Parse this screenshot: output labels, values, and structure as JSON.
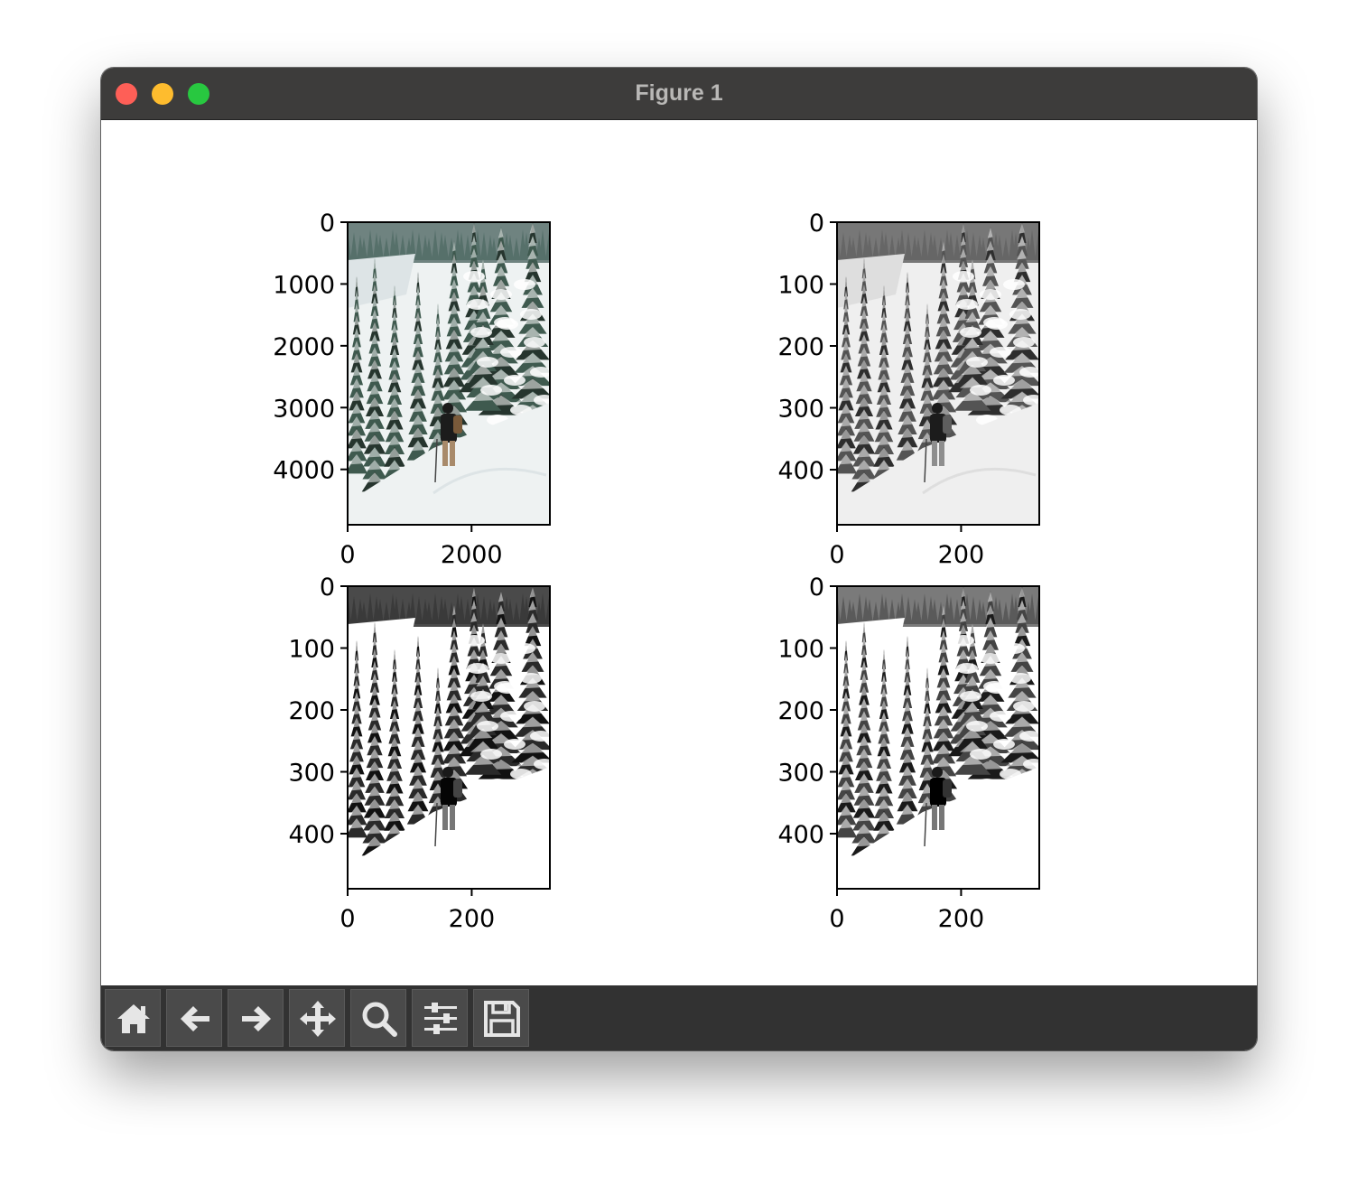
{
  "window": {
    "title": "Figure 1"
  },
  "toolbar": {
    "buttons": [
      {
        "name": "home-button",
        "icon": "home-icon"
      },
      {
        "name": "back-button",
        "icon": "arrow-left-icon"
      },
      {
        "name": "forward-button",
        "icon": "arrow-right-icon"
      },
      {
        "name": "pan-button",
        "icon": "move-icon"
      },
      {
        "name": "zoom-button",
        "icon": "search-icon"
      },
      {
        "name": "configure-subplots-button",
        "icon": "sliders-icon"
      },
      {
        "name": "save-button",
        "icon": "floppy-disk-icon"
      }
    ]
  },
  "chart_data": [
    {
      "type": "image",
      "image": "snowy forest hiker, color",
      "x_ticks": [
        "0",
        "2000"
      ],
      "y_ticks": [
        "0",
        "1000",
        "2000",
        "3000",
        "4000"
      ],
      "xlim": [
        0,
        3264
      ],
      "ylim": [
        4896,
        0
      ]
    },
    {
      "type": "image",
      "image": "snowy forest hiker, grayscale",
      "x_ticks": [
        "0",
        "200"
      ],
      "y_ticks": [
        "0",
        "100",
        "200",
        "300",
        "400"
      ],
      "xlim": [
        0,
        326
      ],
      "ylim": [
        489,
        0
      ]
    },
    {
      "type": "image",
      "image": "snowy forest hiker, high contrast",
      "x_ticks": [
        "0",
        "200"
      ],
      "y_ticks": [
        "0",
        "100",
        "200",
        "300",
        "400"
      ],
      "xlim": [
        0,
        326
      ],
      "ylim": [
        489,
        0
      ]
    },
    {
      "type": "image",
      "image": "snowy forest hiker, binary threshold",
      "x_ticks": [
        "0",
        "200"
      ],
      "y_ticks": [
        "0",
        "100",
        "200",
        "300",
        "400"
      ],
      "xlim": [
        0,
        326
      ],
      "ylim": [
        489,
        0
      ]
    }
  ]
}
